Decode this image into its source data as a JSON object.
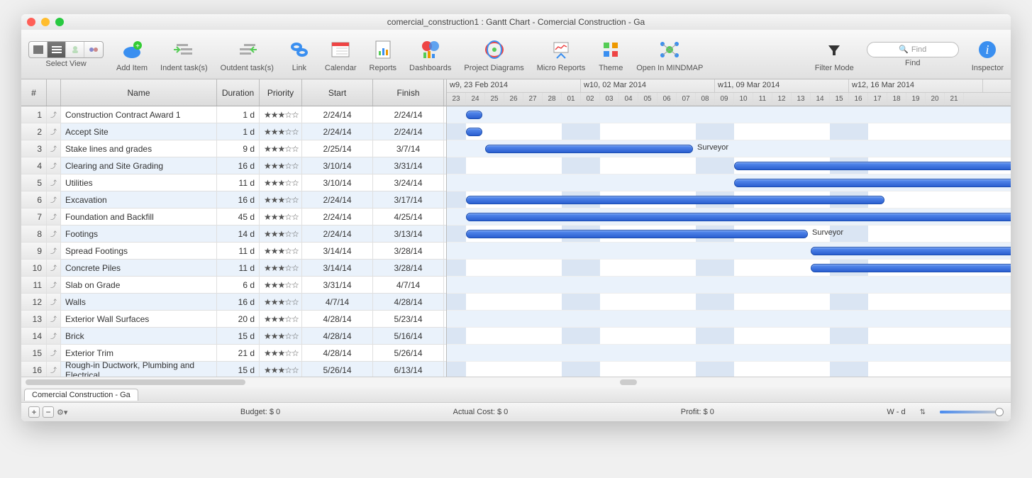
{
  "window": {
    "title": "comercial_construction1 : Gantt Chart - Comercial Construction - Ga"
  },
  "toolbar": {
    "select_view": "Select View",
    "add_item": "Add Item",
    "indent": "Indent task(s)",
    "outdent": "Outdent task(s)",
    "link": "Link",
    "calendar": "Calendar",
    "reports": "Reports",
    "dashboards": "Dashboards",
    "project_diagrams": "Project Diagrams",
    "micro_reports": "Micro Reports",
    "theme": "Theme",
    "open_mindmap": "Open In MINDMAP",
    "filter_mode": "Filter Mode",
    "find": "Find",
    "find_placeholder": "Find",
    "inspector": "Inspector"
  },
  "columns": {
    "num": "#",
    "name": "Name",
    "duration": "Duration",
    "priority": "Priority",
    "start": "Start",
    "finish": "Finish"
  },
  "timeline": {
    "weeks": [
      {
        "label": "w9, 23 Feb 2014",
        "span": 7
      },
      {
        "label": "w10, 02 Mar 2014",
        "span": 7
      },
      {
        "label": "w11, 09 Mar 2014",
        "span": 7
      },
      {
        "label": "w12, 16 Mar 2014",
        "span": 7
      }
    ],
    "days": [
      "23",
      "24",
      "25",
      "26",
      "27",
      "28",
      "01",
      "02",
      "03",
      "04",
      "05",
      "06",
      "07",
      "08",
      "09",
      "10",
      "11",
      "12",
      "13",
      "14",
      "15",
      "16",
      "17",
      "18",
      "19",
      "20",
      "21"
    ],
    "origin": "2014-02-23",
    "weekend_indices": [
      0,
      6,
      7,
      13,
      14,
      20,
      21
    ]
  },
  "tasks": [
    {
      "num": 1,
      "name": "Construction Contract Award 1",
      "duration": "1 d",
      "priority": "★★★☆☆",
      "start": "2/24/14",
      "finish": "2/24/14",
      "bar_start": 1,
      "bar_len": 1,
      "label": ""
    },
    {
      "num": 2,
      "name": "Accept Site",
      "duration": "1 d",
      "priority": "★★★☆☆",
      "start": "2/24/14",
      "finish": "2/24/14",
      "bar_start": 1,
      "bar_len": 1,
      "label": ""
    },
    {
      "num": 3,
      "name": "Stake lines and grades",
      "duration": "9 d",
      "priority": "★★★☆☆",
      "start": "2/25/14",
      "finish": "3/7/14",
      "bar_start": 2,
      "bar_len": 11,
      "label": "Surveyor"
    },
    {
      "num": 4,
      "name": "Clearing and Site Grading",
      "duration": "16 d",
      "priority": "★★★☆☆",
      "start": "3/10/14",
      "finish": "3/31/14",
      "bar_start": 15,
      "bar_len": 22,
      "label": ""
    },
    {
      "num": 5,
      "name": "Utilities",
      "duration": "11 d",
      "priority": "★★★☆☆",
      "start": "3/10/14",
      "finish": "3/24/14",
      "bar_start": 15,
      "bar_len": 15,
      "label": ""
    },
    {
      "num": 6,
      "name": "Excavation",
      "duration": "16 d",
      "priority": "★★★☆☆",
      "start": "2/24/14",
      "finish": "3/17/14",
      "bar_start": 1,
      "bar_len": 22,
      "label": ""
    },
    {
      "num": 7,
      "name": "Foundation and Backfill",
      "duration": "45 d",
      "priority": "★★★☆☆",
      "start": "2/24/14",
      "finish": "4/25/14",
      "bar_start": 1,
      "bar_len": 61,
      "label": ""
    },
    {
      "num": 8,
      "name": "Footings",
      "duration": "14 d",
      "priority": "★★★☆☆",
      "start": "2/24/14",
      "finish": "3/13/14",
      "bar_start": 1,
      "bar_len": 18,
      "label": "Surveyor"
    },
    {
      "num": 9,
      "name": "Spread Footings",
      "duration": "11 d",
      "priority": "★★★☆☆",
      "start": "3/14/14",
      "finish": "3/28/14",
      "bar_start": 19,
      "bar_len": 15,
      "label": ""
    },
    {
      "num": 10,
      "name": "Concrete Piles",
      "duration": "11 d",
      "priority": "★★★☆☆",
      "start": "3/14/14",
      "finish": "3/28/14",
      "bar_start": 19,
      "bar_len": 15,
      "label": ""
    },
    {
      "num": 11,
      "name": "Slab on Grade",
      "duration": "6 d",
      "priority": "★★★☆☆",
      "start": "3/31/14",
      "finish": "4/7/14",
      "bar_start": 36,
      "bar_len": 8,
      "label": ""
    },
    {
      "num": 12,
      "name": "Walls",
      "duration": "16 d",
      "priority": "★★★☆☆",
      "start": "4/7/14",
      "finish": "4/28/14",
      "bar_start": 43,
      "bar_len": 22,
      "label": ""
    },
    {
      "num": 13,
      "name": "Exterior Wall Surfaces",
      "duration": "20 d",
      "priority": "★★★☆☆",
      "start": "4/28/14",
      "finish": "5/23/14",
      "bar_start": 64,
      "bar_len": 26,
      "label": ""
    },
    {
      "num": 14,
      "name": "Brick",
      "duration": "15 d",
      "priority": "★★★☆☆",
      "start": "4/28/14",
      "finish": "5/16/14",
      "bar_start": 64,
      "bar_len": 19,
      "label": ""
    },
    {
      "num": 15,
      "name": "Exterior Trim",
      "duration": "21 d",
      "priority": "★★★☆☆",
      "start": "4/28/14",
      "finish": "5/26/14",
      "bar_start": 64,
      "bar_len": 29,
      "label": ""
    },
    {
      "num": 16,
      "name": "Rough-in Ductwork, Plumbing and Electrical",
      "duration": "15 d",
      "priority": "★★★☆☆",
      "start": "5/26/14",
      "finish": "6/13/14",
      "bar_start": 92,
      "bar_len": 19,
      "label": ""
    }
  ],
  "footer": {
    "tab": "Comercial Construction - Ga",
    "budget": "Budget: $ 0",
    "actual": "Actual Cost: $ 0",
    "profit": "Profit: $ 0",
    "zoom": "W - d"
  },
  "chart_data": {
    "type": "gantt",
    "title": "Comercial Construction - Gantt Chart",
    "x_unit": "days",
    "x_origin": "2014-02-23",
    "tasks": [
      {
        "name": "Construction Contract Award 1",
        "start": "2014-02-24",
        "end": "2014-02-24",
        "resource": ""
      },
      {
        "name": "Accept Site",
        "start": "2014-02-24",
        "end": "2014-02-24",
        "resource": ""
      },
      {
        "name": "Stake lines and grades",
        "start": "2014-02-25",
        "end": "2014-03-07",
        "resource": "Surveyor"
      },
      {
        "name": "Clearing and Site Grading",
        "start": "2014-03-10",
        "end": "2014-03-31",
        "resource": ""
      },
      {
        "name": "Utilities",
        "start": "2014-03-10",
        "end": "2014-03-24",
        "resource": ""
      },
      {
        "name": "Excavation",
        "start": "2014-02-24",
        "end": "2014-03-17",
        "resource": ""
      },
      {
        "name": "Foundation and Backfill",
        "start": "2014-02-24",
        "end": "2014-04-25",
        "resource": ""
      },
      {
        "name": "Footings",
        "start": "2014-02-24",
        "end": "2014-03-13",
        "resource": "Surveyor"
      },
      {
        "name": "Spread Footings",
        "start": "2014-03-14",
        "end": "2014-03-28",
        "resource": ""
      },
      {
        "name": "Concrete Piles",
        "start": "2014-03-14",
        "end": "2014-03-28",
        "resource": ""
      },
      {
        "name": "Slab on Grade",
        "start": "2014-03-31",
        "end": "2014-04-07",
        "resource": ""
      },
      {
        "name": "Walls",
        "start": "2014-04-07",
        "end": "2014-04-28",
        "resource": ""
      },
      {
        "name": "Exterior Wall Surfaces",
        "start": "2014-04-28",
        "end": "2014-05-23",
        "resource": ""
      },
      {
        "name": "Brick",
        "start": "2014-04-28",
        "end": "2014-05-16",
        "resource": ""
      },
      {
        "name": "Exterior Trim",
        "start": "2014-04-28",
        "end": "2014-05-26",
        "resource": ""
      },
      {
        "name": "Rough-in Ductwork, Plumbing and Electrical",
        "start": "2014-05-26",
        "end": "2014-06-13",
        "resource": ""
      }
    ]
  }
}
